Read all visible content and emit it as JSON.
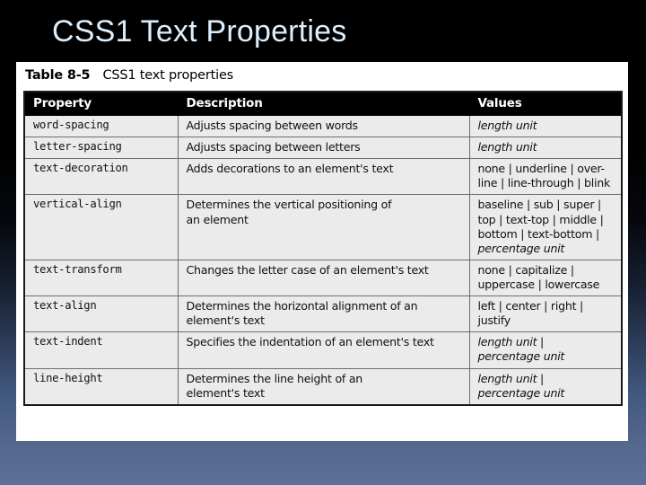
{
  "slide": {
    "title": "CSS1 Text Properties",
    "title_color": "#dcefff",
    "background_top_color": "#000000",
    "background_bottom_color": "#5d7099"
  },
  "table": {
    "caption_label": "Table 8-5",
    "caption_text": "CSS1 text properties",
    "header_background": "#000000",
    "header_text_color": "#ffffff",
    "cell_background": "#ebebeb",
    "columns": [
      "Property",
      "Description",
      "Values"
    ],
    "rows": [
      {
        "property": "word-spacing",
        "description": [
          "Adjusts spacing between words"
        ],
        "values": [
          "length unit"
        ],
        "values_italic": true
      },
      {
        "property": "letter-spacing",
        "description": [
          "Adjusts spacing between letters"
        ],
        "values": [
          "length unit"
        ],
        "values_italic": true
      },
      {
        "property": "text-decoration",
        "description": [
          "Adds decorations to an element's text"
        ],
        "values": [
          "none | underline | over-",
          "line | line-through | blink"
        ],
        "values_italic": false
      },
      {
        "property": "vertical-align",
        "description": [
          "Determines the vertical positioning of",
          "an element"
        ],
        "values": [
          "baseline | sub | super |",
          "top | text-top | middle |",
          "bottom | text-bottom |",
          "percentage unit"
        ],
        "values_italic": false,
        "values_italic_lines": [
          3
        ]
      },
      {
        "property": "text-transform",
        "description": [
          "Changes the letter case of an element's text"
        ],
        "values": [
          "none | capitalize |",
          "uppercase | lowercase"
        ],
        "values_italic": false
      },
      {
        "property": "text-align",
        "description": [
          "Determines the horizontal alignment of an",
          "element's text"
        ],
        "values": [
          "left | center | right |",
          "justify"
        ],
        "values_italic": false
      },
      {
        "property": "text-indent",
        "description": [
          "Specifies the indentation of an element's text"
        ],
        "values": [
          "length unit |",
          "percentage unit"
        ],
        "values_italic": true
      },
      {
        "property": "line-height",
        "description": [
          "Determines the line height of an",
          "element's text"
        ],
        "values": [
          "length unit |",
          "percentage unit"
        ],
        "values_italic": true
      }
    ]
  }
}
